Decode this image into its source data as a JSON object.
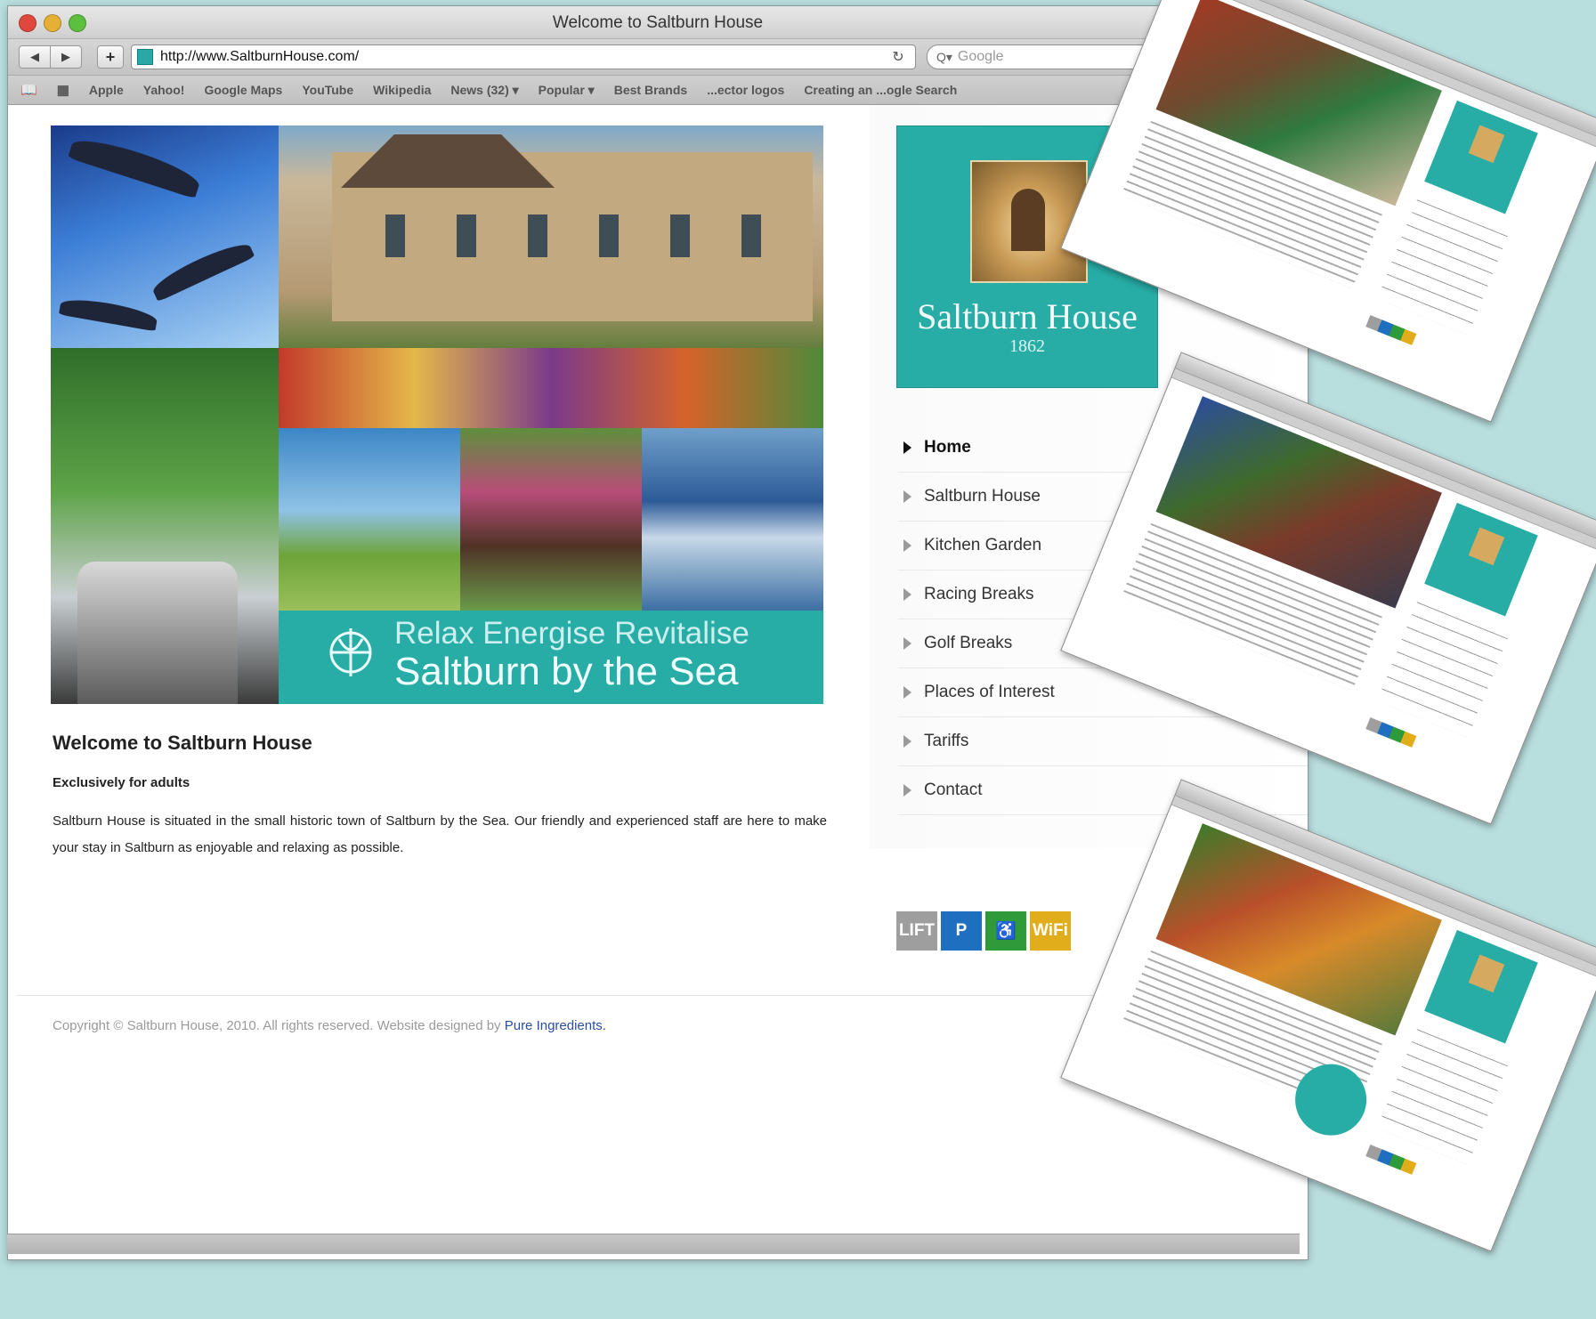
{
  "browser": {
    "window_title": "Welcome to Saltburn House",
    "url": "http://www.SaltburnHouse.com/",
    "search_placeholder": "Google",
    "bookmarks": [
      "Apple",
      "Yahoo!",
      "Google Maps",
      "YouTube",
      "Wikipedia",
      "News (32) ▾",
      "Popular ▾",
      "Best Brands",
      "...ector logos",
      "Creating an ...ogle Search"
    ]
  },
  "hero": {
    "banner_line1": "Relax Energise Revitalise",
    "banner_line2": "Saltburn by the Sea"
  },
  "content": {
    "heading": "Welcome to Saltburn House",
    "subheading": "Exclusively for adults",
    "intro": "Saltburn House is situated in the small historic town of Saltburn by the Sea. Our friendly and experienced staff are here to make your stay in Saltburn as enjoyable and relaxing as possible."
  },
  "logo": {
    "name": "Saltburn House",
    "year": "1862"
  },
  "nav": {
    "items": [
      {
        "label": "Home",
        "active": true
      },
      {
        "label": "Saltburn House",
        "active": false
      },
      {
        "label": "Kitchen Garden",
        "active": false
      },
      {
        "label": "Racing Breaks",
        "active": false
      },
      {
        "label": "Golf Breaks",
        "active": false
      },
      {
        "label": "Places of Interest",
        "active": false
      },
      {
        "label": "Tariffs",
        "active": false
      },
      {
        "label": "Contact",
        "active": false
      }
    ]
  },
  "amenities": [
    {
      "label": "LIFT",
      "color": "#9e9e9e"
    },
    {
      "label": "P",
      "color": "#1e6fc0"
    },
    {
      "label": "♿",
      "color": "#2f9a3a"
    },
    {
      "label": "WiFi",
      "color": "#e2ad1b"
    }
  ],
  "footer": {
    "text": "Copyright © Saltburn House, 2010. All rights reserved. Website designed by ",
    "link": "Pure Ingredients."
  },
  "colors": {
    "brand_teal": "#27ada6",
    "page_background": "#b9dede"
  }
}
